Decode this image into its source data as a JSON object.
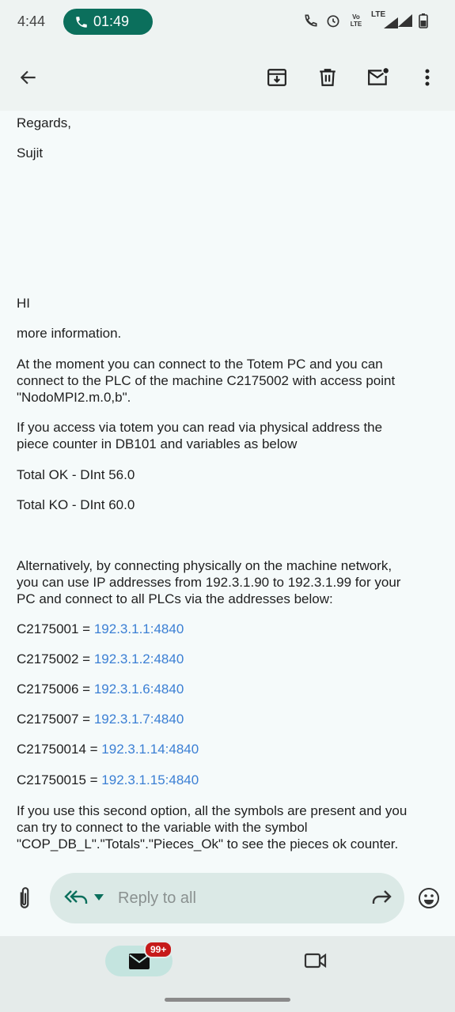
{
  "status_bar": {
    "time": "4:44",
    "call_timer": "01:49",
    "network_label": "LTE",
    "volte_label": "Vo LTE"
  },
  "toolbar": {
    "back": "arrow-back-icon",
    "archive": "archive-icon",
    "delete": "trash-icon",
    "mark_unread": "mark-unread-icon",
    "more": "more-vert-icon"
  },
  "message": {
    "regards": "Regards,",
    "signature": "Sujit",
    "greeting": "HI",
    "p1": "more information.",
    "p2_line1": "At the moment you can connect to the Totem PC and you can",
    "p2_line2": "connect to the PLC of the machine C2175002 with access point",
    "p2_line3": "\"NodoMPI2.m.0,b\".",
    "p3_line1": "If you access via totem you can read via physical address the",
    "p3_line2": "piece counter in DB101 and variables as below",
    "total_ok": "Total OK - DInt 56.0",
    "total_ko": "Total KO - DInt 60.0",
    "p4_line1": "Alternatively, by connecting physically on the machine network,",
    "p4_line2": "you can use IP addresses from 192.3.1.90 to 192.3.1.99 for your",
    "p4_line3": "PC and connect to all PLCs via the addresses below:",
    "plcs": [
      {
        "name": "C2175001 = ",
        "addr": "192.3.1.1:4840"
      },
      {
        "name": "C2175002 = ",
        "addr": "192.3.1.2:4840"
      },
      {
        "name": "C2175006 = ",
        "addr": "192.3.1.6:4840"
      },
      {
        "name": "C2175007 = ",
        "addr": "192.3.1.7:4840"
      },
      {
        "name": "C21750014 = ",
        "addr": "192.3.1.14:4840"
      },
      {
        "name": "C21750015 = ",
        "addr": "192.3.1.15:4840"
      }
    ],
    "p5_line1": "If you use this second option, all the symbols are present and you",
    "p5_line2": "can try to connect to the variable with the symbol",
    "p5_line3": "\"COP_DB_L\".\"Totals\".\"Pieces_Ok\" to see the pieces ok counter."
  },
  "reply": {
    "placeholder": "Reply to all"
  },
  "bottom_nav": {
    "mail_badge": "99+"
  },
  "colors": {
    "accent": "#0b6f5c",
    "link": "#3b7fd4",
    "badge": "#c61a1a"
  }
}
